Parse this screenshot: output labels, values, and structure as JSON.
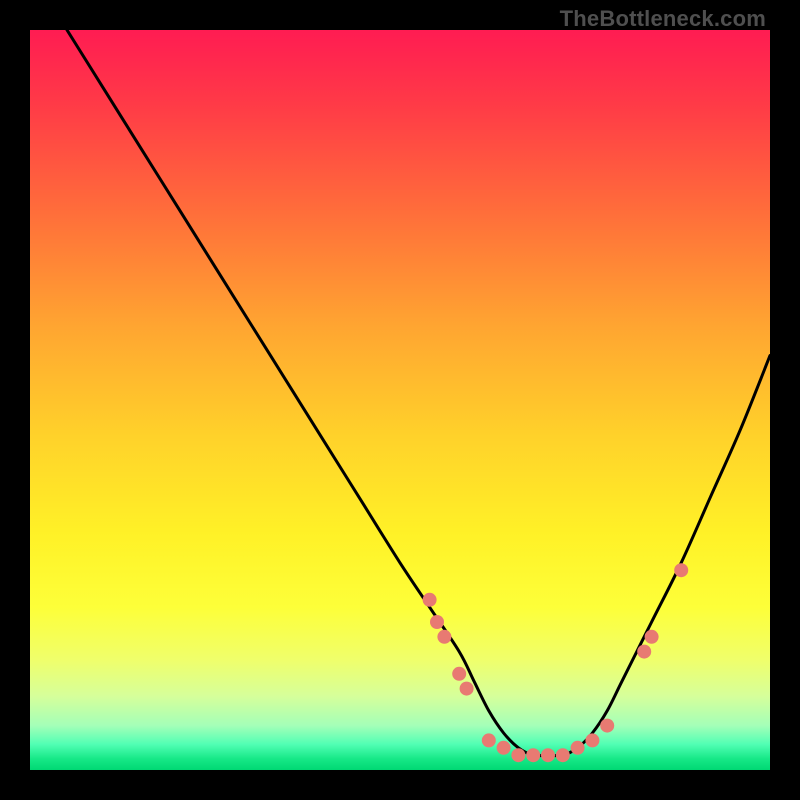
{
  "watermark": "TheBottleneck.com",
  "colors": {
    "background": "#000000",
    "curve": "#000000",
    "markers": "#e87a72",
    "watermark": "#4f4f4f",
    "gradient_stops": [
      {
        "offset": 0.0,
        "color": "#ff1c52"
      },
      {
        "offset": 0.1,
        "color": "#ff3a47"
      },
      {
        "offset": 0.25,
        "color": "#ff6f3a"
      },
      {
        "offset": 0.4,
        "color": "#ffa531"
      },
      {
        "offset": 0.55,
        "color": "#ffd22a"
      },
      {
        "offset": 0.68,
        "color": "#fff127"
      },
      {
        "offset": 0.78,
        "color": "#fdff39"
      },
      {
        "offset": 0.85,
        "color": "#f0ff6a"
      },
      {
        "offset": 0.9,
        "color": "#d6ff9a"
      },
      {
        "offset": 0.94,
        "color": "#a4ffb8"
      },
      {
        "offset": 0.965,
        "color": "#52ffb4"
      },
      {
        "offset": 0.985,
        "color": "#16e887"
      },
      {
        "offset": 1.0,
        "color": "#00d873"
      }
    ]
  },
  "chart_data": {
    "type": "line",
    "title": "",
    "xlabel": "",
    "ylabel": "",
    "xlim": [
      0,
      100
    ],
    "ylim": [
      0,
      100
    ],
    "series": [
      {
        "name": "bottleneck-curve",
        "x": [
          5,
          10,
          15,
          20,
          25,
          30,
          35,
          40,
          45,
          50,
          54,
          58,
          60,
          62,
          64,
          66,
          68,
          70,
          72,
          74,
          76,
          78,
          80,
          84,
          88,
          92,
          96,
          100
        ],
        "y": [
          100,
          92,
          84,
          76,
          68,
          60,
          52,
          44,
          36,
          28,
          22,
          16,
          12,
          8,
          5,
          3,
          2,
          2,
          2,
          3,
          5,
          8,
          12,
          20,
          28,
          37,
          46,
          56
        ]
      }
    ],
    "markers": {
      "name": "highlight-points",
      "points": [
        {
          "x": 54,
          "y": 23
        },
        {
          "x": 55,
          "y": 20
        },
        {
          "x": 56,
          "y": 18
        },
        {
          "x": 58,
          "y": 13
        },
        {
          "x": 59,
          "y": 11
        },
        {
          "x": 62,
          "y": 4
        },
        {
          "x": 64,
          "y": 3
        },
        {
          "x": 66,
          "y": 2
        },
        {
          "x": 68,
          "y": 2
        },
        {
          "x": 70,
          "y": 2
        },
        {
          "x": 72,
          "y": 2
        },
        {
          "x": 74,
          "y": 3
        },
        {
          "x": 76,
          "y": 4
        },
        {
          "x": 78,
          "y": 6
        },
        {
          "x": 83,
          "y": 16
        },
        {
          "x": 84,
          "y": 18
        },
        {
          "x": 88,
          "y": 27
        }
      ]
    }
  }
}
